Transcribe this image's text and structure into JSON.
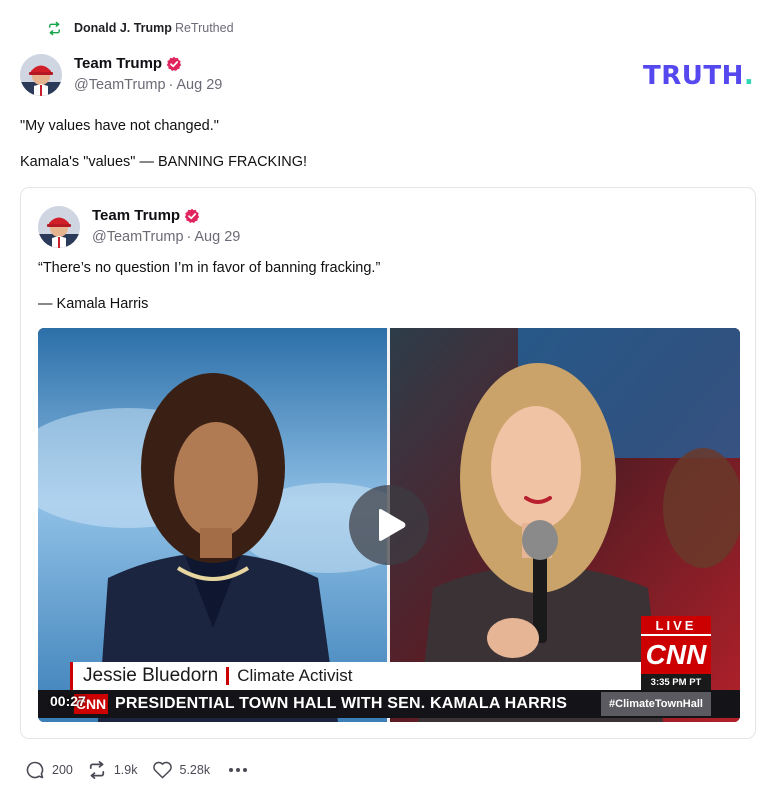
{
  "retruth": {
    "user": "Donald J. Trump",
    "action": "ReTruthed"
  },
  "post": {
    "author_name": "Team Trump",
    "handle": "@TeamTrump",
    "date": "Aug 29",
    "lines": [
      "\"My values have not changed.\"",
      "Kamala's \"values\" — BANNING FRACKING!"
    ]
  },
  "logo": {
    "text": "TRUTH",
    "dot": "."
  },
  "quote": {
    "author_name": "Team Trump",
    "handle": "@TeamTrump",
    "date": "Aug 29",
    "lines": [
      "“There’s no question I’m in favor of banning fracking.”",
      "— Kamala Harris"
    ]
  },
  "video": {
    "timecode": "00:27",
    "lower_third_name": "Jessie Bluedorn",
    "lower_third_title": "Climate Activist",
    "ticker_text": "PRESIDENTIAL TOWN HALL WITH SEN. KAMALA HARRIS",
    "ticker_logo": "CNN",
    "hashtag": "#ClimateTownHall",
    "live_label": "LIVE",
    "network": "CNN",
    "clock": "3:35 PM PT"
  },
  "actions": {
    "replies": "200",
    "retruths": "1.9k",
    "likes": "5.28k"
  },
  "colors": {
    "brand": "#5448ee",
    "brand_dot": "#2fd7b5",
    "verified": "#e0245e",
    "retruth_green": "#16a34a",
    "cnn_red": "#cc0000"
  }
}
